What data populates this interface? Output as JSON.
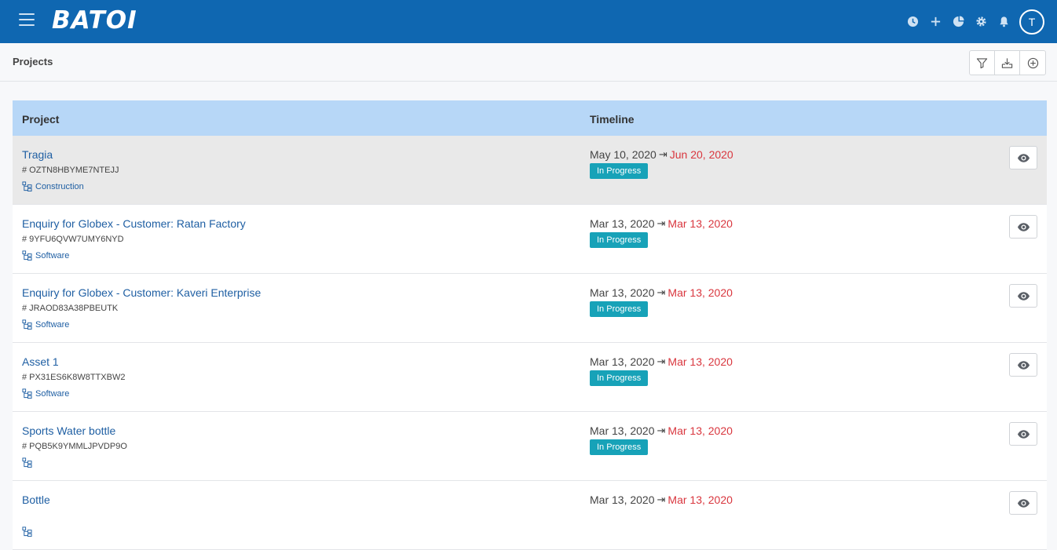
{
  "app": {
    "logo_text": "BATOI"
  },
  "topbar": {
    "avatar_initial": "T"
  },
  "page": {
    "title": "Projects"
  },
  "table": {
    "headers": {
      "project": "Project",
      "timeline": "Timeline"
    },
    "rows": [
      {
        "name": "Tragia",
        "code": "# OZTN8HBYME7NTEJJ",
        "category": "Construction",
        "start": "May 10, 2020",
        "end": "Jun 20, 2020",
        "status": "In Progress"
      },
      {
        "name": "Enquiry for Globex - Customer: Ratan Factory",
        "code": "# 9YFU6QVW7UMY6NYD",
        "category": "Software",
        "start": "Mar 13, 2020",
        "end": "Mar 13, 2020",
        "status": "In Progress"
      },
      {
        "name": "Enquiry for Globex - Customer: Kaveri Enterprise",
        "code": "# JRAOD83A38PBEUTK",
        "category": "Software",
        "start": "Mar 13, 2020",
        "end": "Mar 13, 2020",
        "status": "In Progress"
      },
      {
        "name": "Asset 1",
        "code": "# PX31ES6K8W8TTXBW2",
        "category": "Software",
        "start": "Mar 13, 2020",
        "end": "Mar 13, 2020",
        "status": "In Progress"
      },
      {
        "name": "Sports Water bottle",
        "code": "# PQB5K9YMMLJPVDP9O",
        "category": "",
        "start": "Mar 13, 2020",
        "end": "Mar 13, 2020",
        "status": "In Progress"
      },
      {
        "name": "Bottle",
        "code": "",
        "category": "",
        "start": "Mar 13, 2020",
        "end": "Mar 13, 2020",
        "status": ""
      }
    ]
  },
  "colors": {
    "topbar": "#0f67b1",
    "header_row": "#b7d7f7",
    "link": "#1f5fa3",
    "end_date": "#d9363e",
    "status_badge": "#17a2b8"
  }
}
